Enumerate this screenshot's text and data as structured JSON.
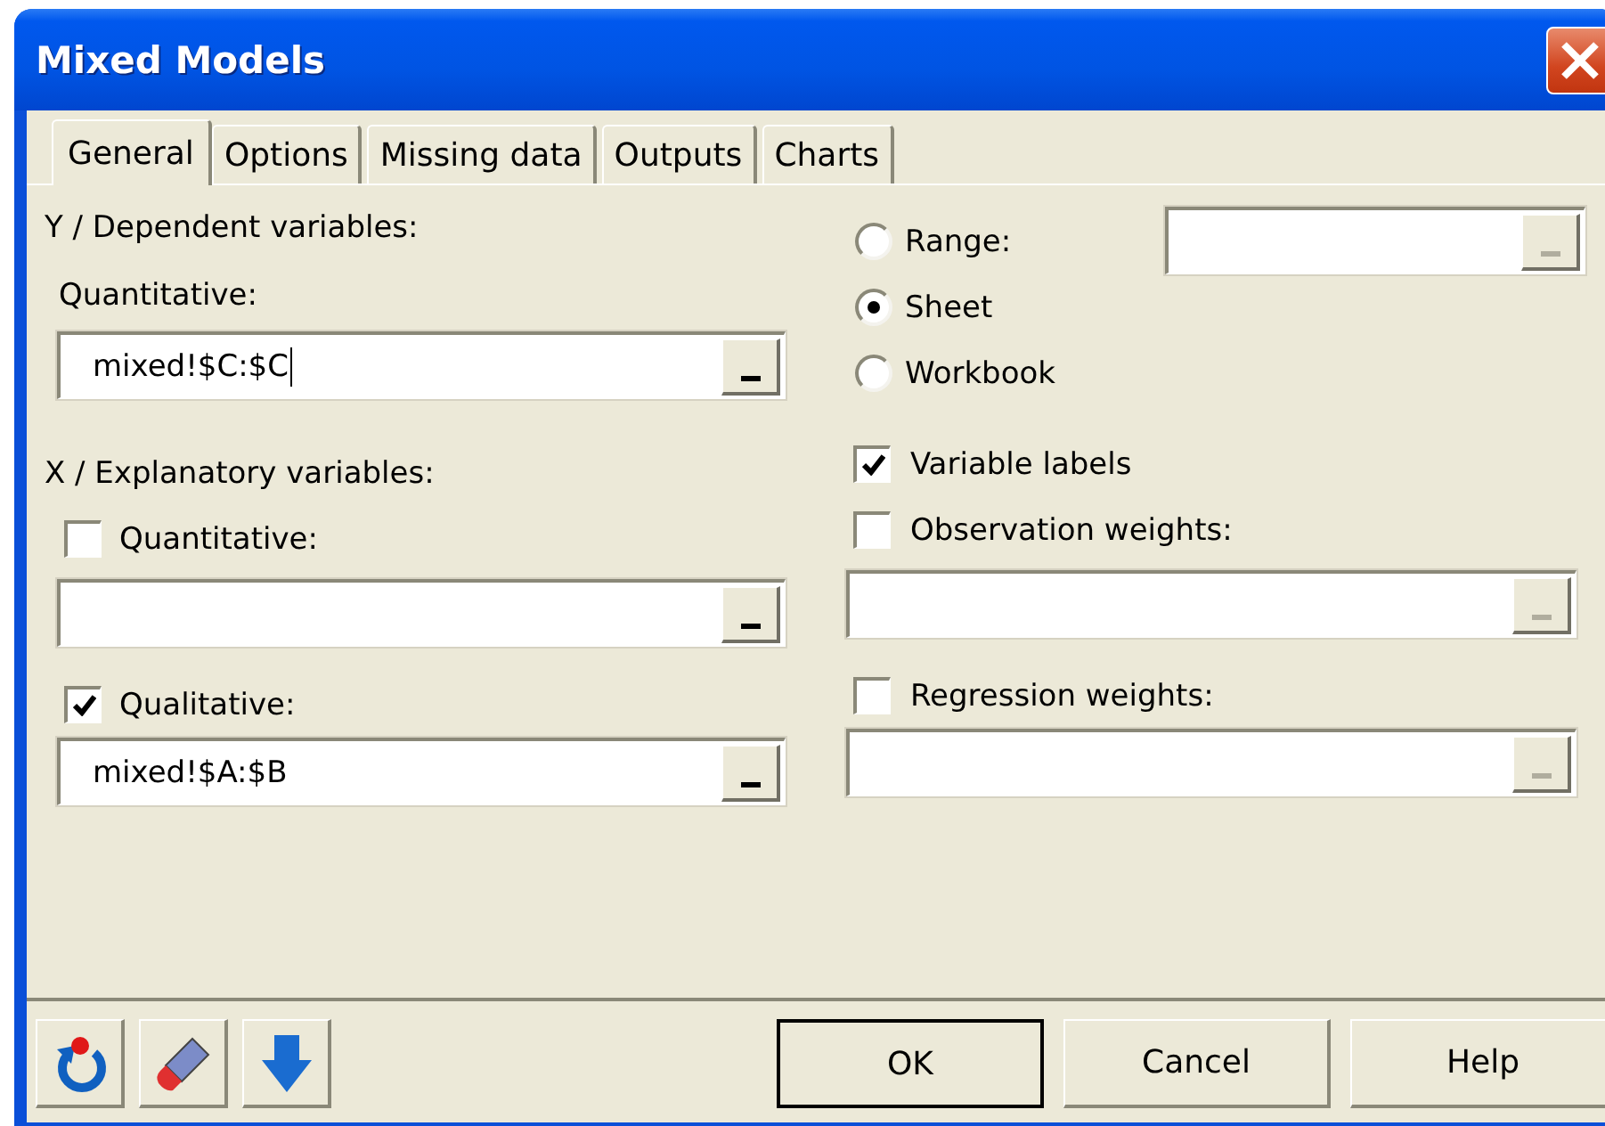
{
  "window": {
    "title": "Mixed Models"
  },
  "tabs": [
    {
      "label": "General",
      "selected": true
    },
    {
      "label": "Options",
      "selected": false
    },
    {
      "label": "Missing data",
      "selected": false
    },
    {
      "label": "Outputs",
      "selected": false
    },
    {
      "label": "Charts",
      "selected": false
    }
  ],
  "dependent": {
    "heading": "Y / Dependent variables:",
    "label": "Quantitative:",
    "field": {
      "value": "mixed!$C:$C",
      "focused": true,
      "disabled": false
    }
  },
  "explanatory": {
    "heading": "X / Explanatory variables:",
    "items": [
      {
        "label": "Quantitative:",
        "checked": false,
        "field": {
          "focused": false,
          "disabled": false
        }
      },
      {
        "label": "Qualitative:",
        "checked": true,
        "field": {
          "value": "mixed!$A:$B",
          "focused": false,
          "disabled": false
        }
      }
    ]
  },
  "scope": {
    "options": [
      {
        "label": "Range:",
        "selected": false
      },
      {
        "label": "Sheet",
        "selected": true
      },
      {
        "label": "Workbook",
        "selected": false
      }
    ],
    "range_field": {
      "focused": false,
      "disabled": true
    }
  },
  "settings": [
    {
      "label": "Variable labels",
      "checked": true
    },
    {
      "label": "Observation weights:",
      "checked": false,
      "field": {
        "focused": false,
        "disabled": true
      }
    },
    {
      "label": "Regression weights:",
      "checked": false,
      "field": {
        "focused": false,
        "disabled": true
      }
    }
  ],
  "tool_buttons": [
    {
      "kind": "reset"
    },
    {
      "kind": "eraser"
    },
    {
      "kind": "down"
    }
  ],
  "buttons": [
    {
      "label": "OK",
      "default": true
    },
    {
      "label": "Cancel",
      "default": false
    },
    {
      "label": "Help",
      "default": false
    }
  ]
}
